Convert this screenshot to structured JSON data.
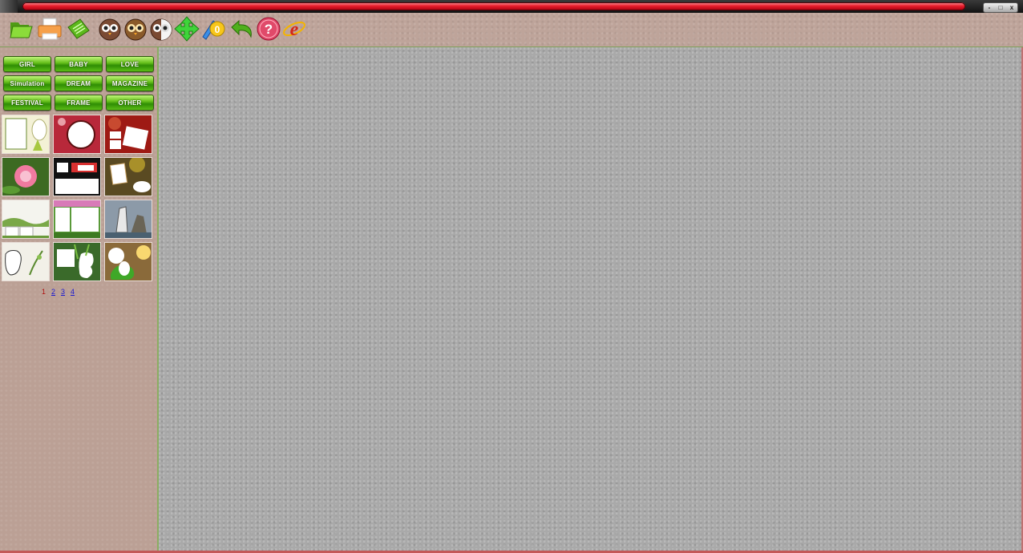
{
  "window": {
    "controls": [
      "-",
      "□",
      "x"
    ]
  },
  "toolbar": {
    "buttons": [
      {
        "name": "open-folder-icon"
      },
      {
        "name": "print-icon"
      },
      {
        "name": "save-icon"
      },
      {
        "name": "owl-icon"
      },
      {
        "name": "owl-icon-2"
      },
      {
        "name": "owl-half-icon"
      },
      {
        "name": "move-arrows-icon"
      },
      {
        "name": "edit-text-icon"
      },
      {
        "name": "undo-icon"
      },
      {
        "name": "help-icon",
        "label": "?"
      },
      {
        "name": "ie-browser-icon",
        "label": "e"
      }
    ]
  },
  "categories": [
    "GIRL",
    "BABY",
    "LOVE",
    "Simulation",
    "DREAM",
    "MAGAZINE",
    "FESTIVAL",
    "FRAME",
    "OTHER"
  ],
  "templates": [
    "template-1",
    "template-2",
    "template-3",
    "template-4",
    "template-5",
    "template-6",
    "template-7",
    "template-8",
    "template-9",
    "template-10",
    "template-11",
    "template-12"
  ],
  "pager": {
    "current": "1",
    "pages": [
      "2",
      "3",
      "4"
    ]
  },
  "colors": {
    "accent_green": "#3f9c0a",
    "title_red": "#e81d2b",
    "canvas": "#a9a9a9",
    "panel": "#bba095"
  }
}
